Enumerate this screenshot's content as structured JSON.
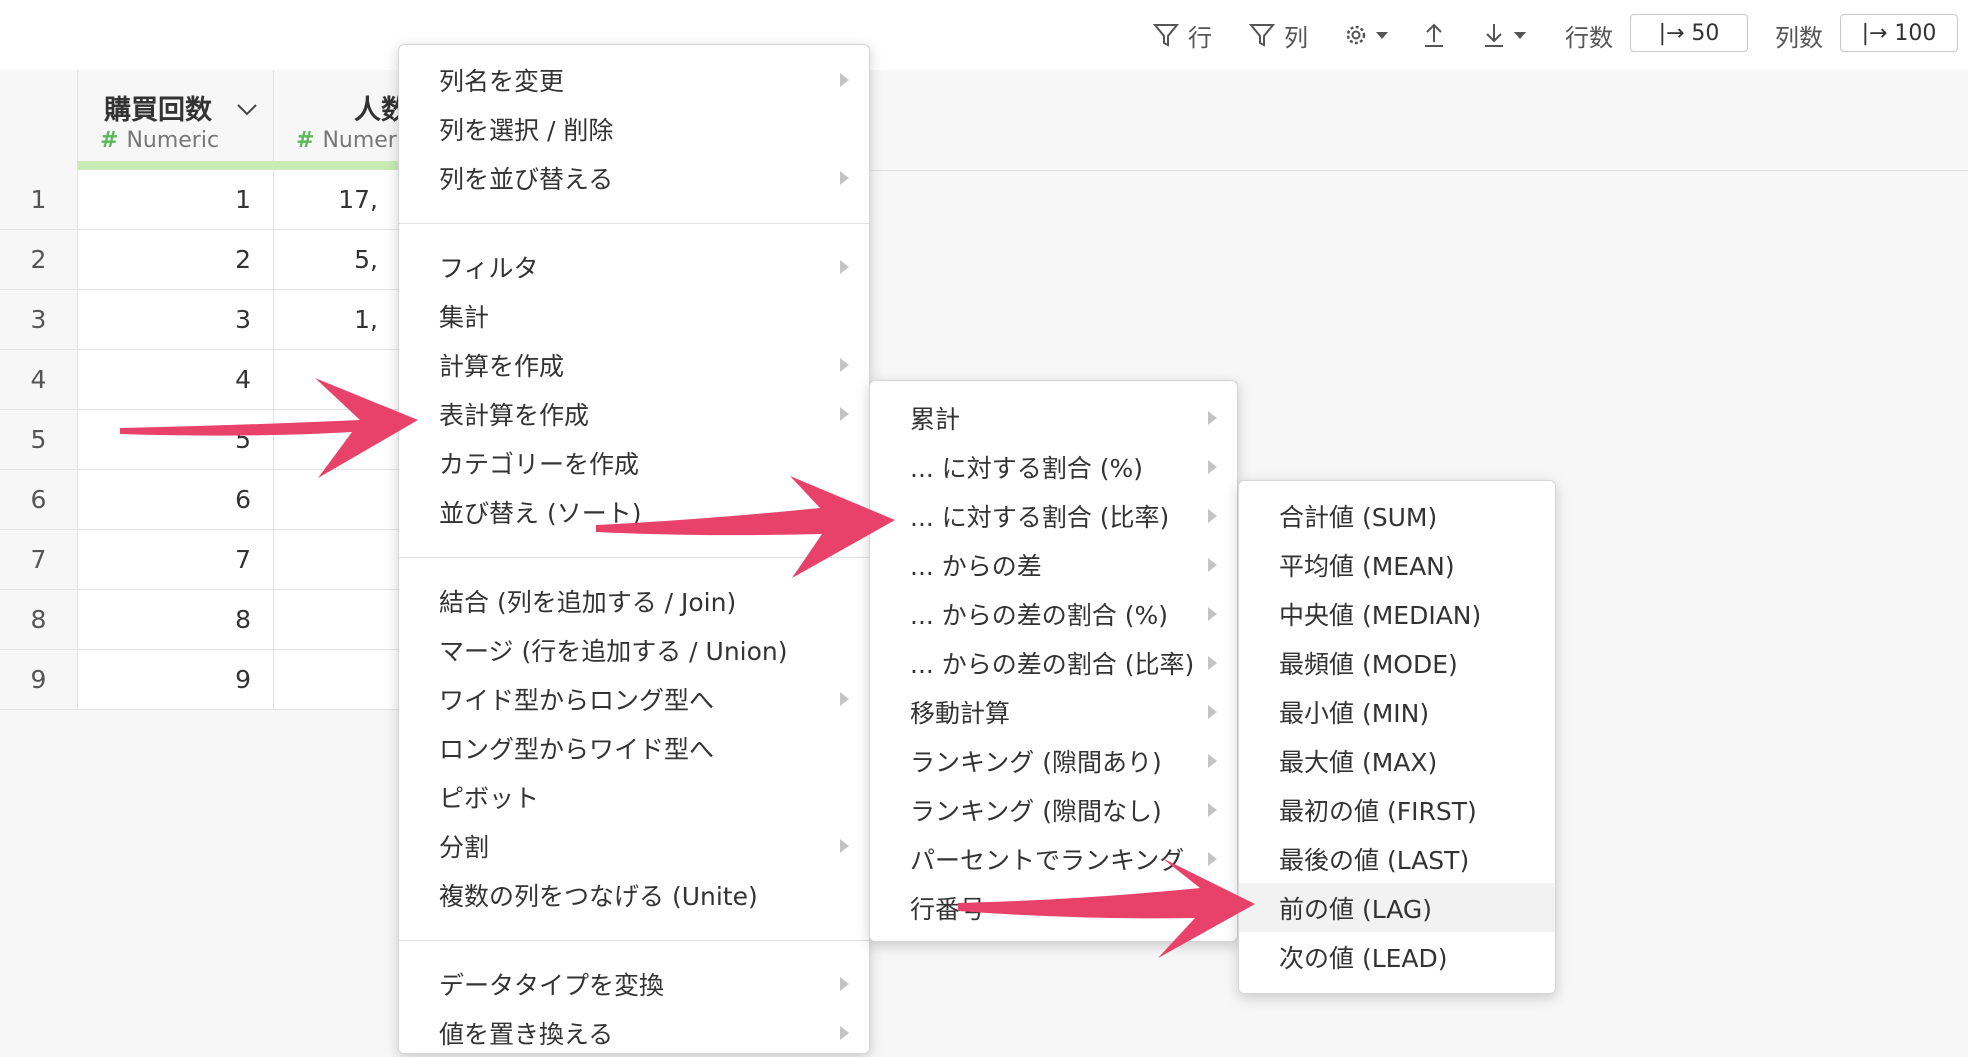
{
  "toolbar": {
    "filter_row": "行",
    "filter_col": "列",
    "rows_label": "行数",
    "rows_value": "|→ 50",
    "cols_label": "列数",
    "cols_value": "|→ 100"
  },
  "table": {
    "columns": [
      {
        "title": "購買回数",
        "type": "Numeric"
      },
      {
        "title": "人数",
        "type": "Numeric"
      }
    ],
    "rows": [
      {
        "index": "1",
        "c1": "1",
        "c2": "17,"
      },
      {
        "index": "2",
        "c1": "2",
        "c2": "5,"
      },
      {
        "index": "3",
        "c1": "3",
        "c2": "1,"
      },
      {
        "index": "4",
        "c1": "4",
        "c2": ""
      },
      {
        "index": "5",
        "c1": "5",
        "c2": ""
      },
      {
        "index": "6",
        "c1": "6",
        "c2": ""
      },
      {
        "index": "7",
        "c1": "7",
        "c2": ""
      },
      {
        "index": "8",
        "c1": "8",
        "c2": ""
      },
      {
        "index": "9",
        "c1": "9",
        "c2": ""
      }
    ]
  },
  "menu1": {
    "items": [
      {
        "label": "列名を変更",
        "submenu": true
      },
      {
        "label": "列を選択 / 削除",
        "submenu": false
      },
      {
        "label": "列を並び替える",
        "submenu": true
      },
      {
        "label": "フィルタ",
        "submenu": true
      },
      {
        "label": "集計",
        "submenu": false
      },
      {
        "label": "計算を作成",
        "submenu": true
      },
      {
        "label": "表計算を作成",
        "submenu": true
      },
      {
        "label": "カテゴリーを作成",
        "submenu": false
      },
      {
        "label": "並び替え (ソート)",
        "submenu": false
      },
      {
        "label": "結合 (列を追加する / Join)",
        "submenu": false
      },
      {
        "label": "マージ (行を追加する / Union)",
        "submenu": false
      },
      {
        "label": "ワイド型からロング型へ",
        "submenu": true
      },
      {
        "label": "ロング型からワイド型へ",
        "submenu": false
      },
      {
        "label": "ピボット",
        "submenu": false
      },
      {
        "label": "分割",
        "submenu": true
      },
      {
        "label": "複数の列をつなげる (Unite)",
        "submenu": false
      },
      {
        "label": "データタイプを変換",
        "submenu": true
      },
      {
        "label": "値を置き換える",
        "submenu": true
      }
    ]
  },
  "menu2": {
    "items": [
      {
        "label": "累計",
        "submenu": true
      },
      {
        "label": "... に対する割合 (%)",
        "submenu": true
      },
      {
        "label": "... に対する割合 (比率)",
        "submenu": true
      },
      {
        "label": "... からの差",
        "submenu": true
      },
      {
        "label": "... からの差の割合 (%)",
        "submenu": true
      },
      {
        "label": "... からの差の割合 (比率)",
        "submenu": true
      },
      {
        "label": "移動計算",
        "submenu": true
      },
      {
        "label": "ランキング (隙間あり)",
        "submenu": true
      },
      {
        "label": "ランキング (隙間なし)",
        "submenu": true
      },
      {
        "label": "パーセントでランキング",
        "submenu": true
      },
      {
        "label": "行番号",
        "submenu": false
      }
    ]
  },
  "menu3": {
    "items": [
      {
        "label": "合計値 (SUM)"
      },
      {
        "label": "平均値 (MEAN)"
      },
      {
        "label": "中央値 (MEDIAN)"
      },
      {
        "label": "最頻値 (MODE)"
      },
      {
        "label": "最小値 (MIN)"
      },
      {
        "label": "最大値 (MAX)"
      },
      {
        "label": "最初の値 (FIRST)"
      },
      {
        "label": "最後の値 (LAST)"
      },
      {
        "label": "前の値 (LAG)"
      },
      {
        "label": "次の値 (LEAD)"
      }
    ],
    "highlighted_index": 8
  },
  "colors": {
    "arrow": "#e8426a",
    "numeric_accent": "#5bb85b",
    "numeric_bar": "#c7ecb5"
  }
}
